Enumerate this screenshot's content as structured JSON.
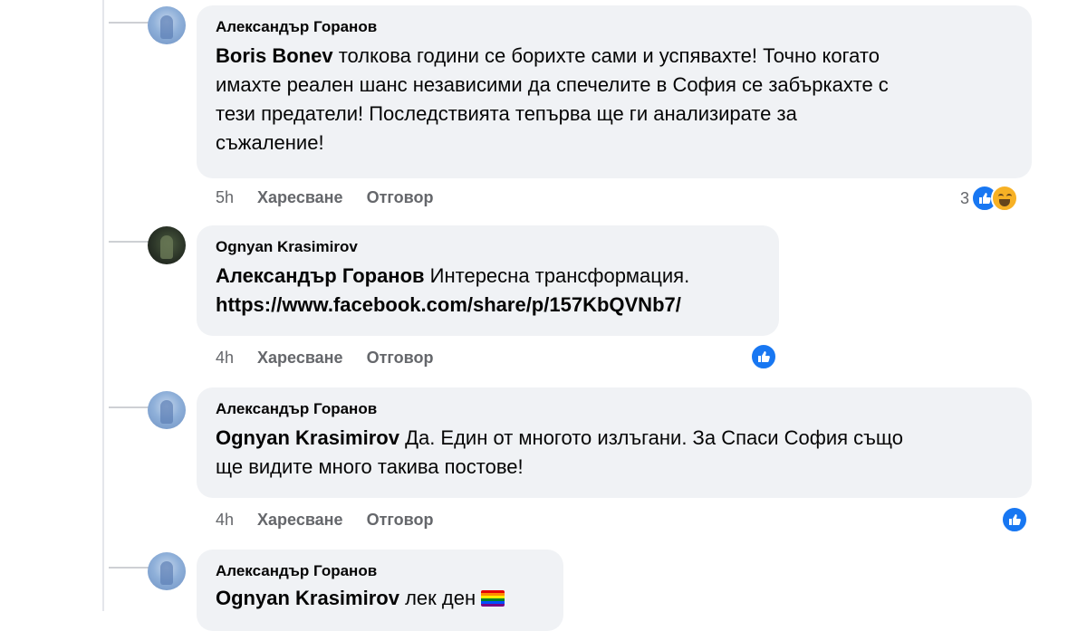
{
  "comments": [
    {
      "author": "Александър Горанов",
      "mention": "Boris Bonev",
      "text_lines": [
        " толкова години се борихте сами и успявахте! Точно когато",
        "имахте реален шанс независими да спечелите в София се забъркахте с",
        "тези предатели! Последствията тепърва ще ги анализирате за",
        "съжаление!"
      ],
      "time": "5h",
      "like_label": "Харесване",
      "reply_label": "Отговор",
      "reaction_count": "3",
      "reactions": [
        "like-icon",
        "haha-icon"
      ]
    },
    {
      "author": "Ognyan Krasimirov",
      "mention": "Александър Горанов",
      "text_lines": [
        " Интересна трансформация.",
        "https://www.facebook.com/share/p/157KbQVNb7/"
      ],
      "time": "4h",
      "like_label": "Харесване",
      "reply_label": "Отговор",
      "reactions": [
        "like-icon"
      ]
    },
    {
      "author": "Александър Горанов",
      "mention": "Ognyan Krasimirov",
      "text_lines": [
        " Да. Един от многото излъгани. За Спаси София също",
        "ще видите много такива постове!"
      ],
      "time": "4h",
      "like_label": "Харесване",
      "reply_label": "Отговор",
      "reactions": [
        "like-icon"
      ]
    },
    {
      "author": "Александър Горанов",
      "mention": "Ognyan Krasimirov",
      "text_lines": [
        " лек ден"
      ],
      "emoji": "rainbow-flag-icon"
    }
  ],
  "colors": {
    "like_blue": "#1877f2",
    "bubble_bg": "#f0f2f5",
    "meta_gray": "#65676b"
  }
}
